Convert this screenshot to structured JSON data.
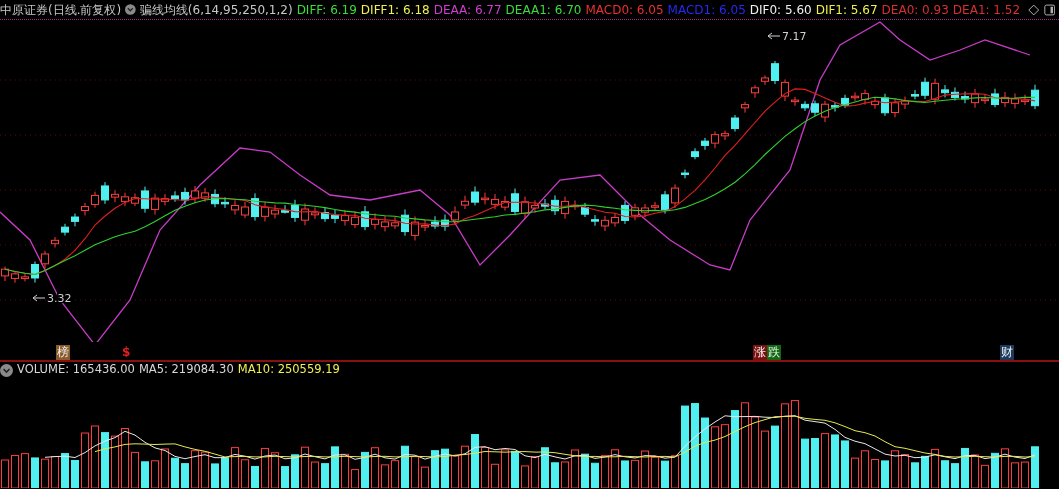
{
  "header": {
    "title": "中原证券(日线.前复权)",
    "indicator": "骗线均线(6,14,95,250,1,2)",
    "values": [
      {
        "text": "DIFF: 6.19",
        "color": "#3cdc3c"
      },
      {
        "text": "DIFF1: 6.18",
        "color": "#f0f050"
      },
      {
        "text": "DEAA: 6.77",
        "color": "#d23cd2"
      },
      {
        "text": "DEAA1: 6.70",
        "color": "#3cdc3c"
      },
      {
        "text": "MACD0: 6.05",
        "color": "#e83030"
      },
      {
        "text": "MACD1: 6.05",
        "color": "#2828f0"
      },
      {
        "text": "DIF0: 5.60",
        "color": "#f0f0f0"
      },
      {
        "text": "DIF1: 5.67",
        "color": "#f0f050"
      },
      {
        "text": "DEA0: 0.93",
        "color": "#d83030"
      },
      {
        "text": "DEA1: 1.52",
        "color": "#d83030"
      }
    ]
  },
  "price_labels": [
    {
      "kind": "high",
      "text": "7.17"
    },
    {
      "kind": "low",
      "text": "3.32"
    }
  ],
  "event_markers": [
    {
      "kind": "tag",
      "text": "榜",
      "color": "#8a5a2a"
    },
    {
      "kind": "glyph",
      "text": "$",
      "color": "#e02020"
    },
    {
      "kind": "tag",
      "text": "涨",
      "color": "#7a1010"
    },
    {
      "kind": "tag",
      "text": "跌",
      "color": "#106a10"
    },
    {
      "kind": "tag",
      "text": "财",
      "color": "#1c3a5c"
    }
  ],
  "volume": {
    "values": [
      {
        "text": "VOLUME: 165436.00",
        "color": "#d8d8d8"
      },
      {
        "text": "MA5: 219084.30",
        "color": "#d8d8d8"
      },
      {
        "text": "MA10: 250559.19",
        "color": "#f0f050"
      }
    ]
  }
}
